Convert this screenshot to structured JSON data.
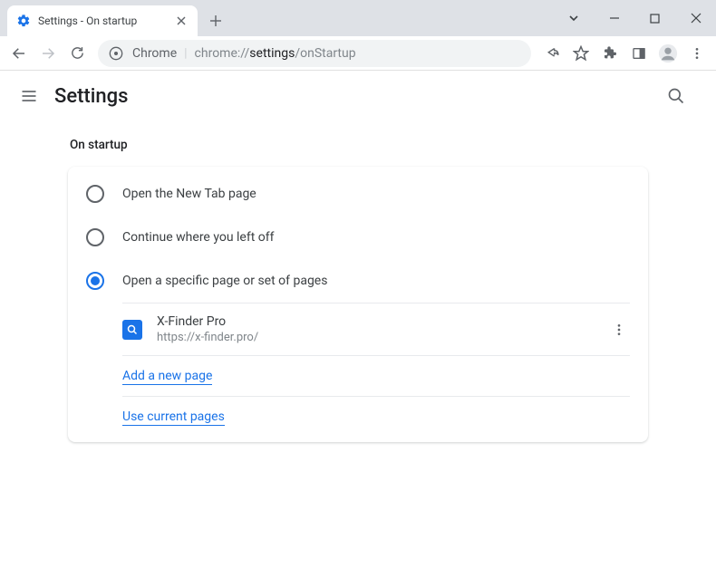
{
  "window": {
    "tab_title": "Settings - On startup"
  },
  "omnibox": {
    "prefix": "Chrome",
    "path_host": "chrome://",
    "path_dark": "settings",
    "path_tail": "/onStartup"
  },
  "header": {
    "title": "Settings"
  },
  "section": {
    "label": "On startup",
    "options": [
      {
        "label": "Open the New Tab page",
        "selected": false
      },
      {
        "label": "Continue where you left off",
        "selected": false
      },
      {
        "label": "Open a specific page or set of pages",
        "selected": true
      }
    ],
    "pages": [
      {
        "name": "X-Finder Pro",
        "url": "https://x-finder.pro/"
      }
    ],
    "add_page": "Add a new page",
    "use_current": "Use current pages"
  }
}
